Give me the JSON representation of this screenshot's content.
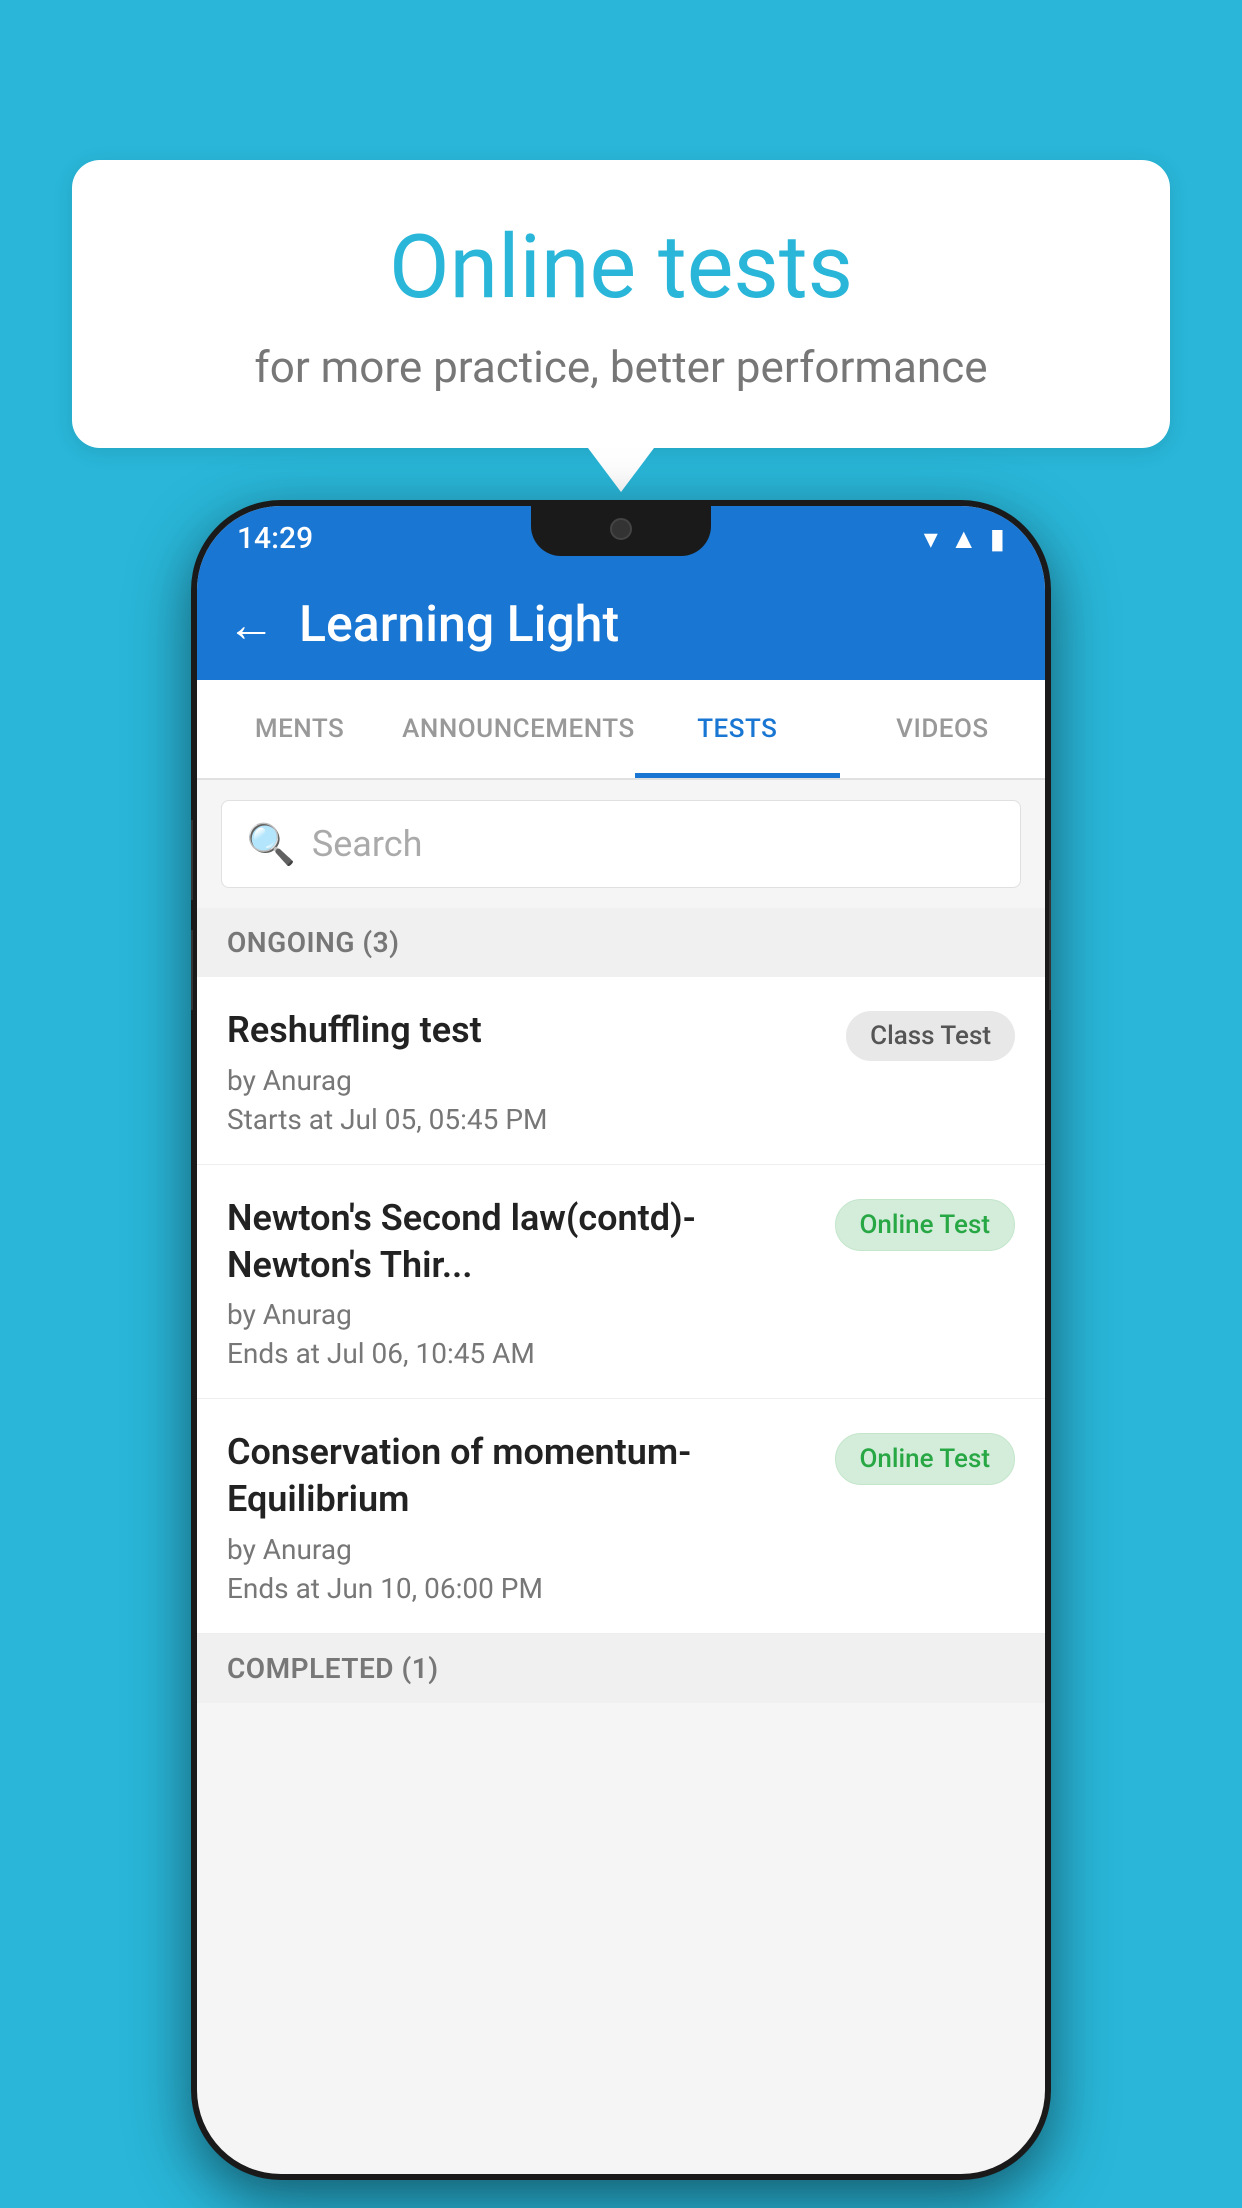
{
  "background_color": "#29b6d8",
  "speech_bubble": {
    "title": "Online tests",
    "subtitle": "for more practice, better performance"
  },
  "phone": {
    "status_bar": {
      "time": "14:29",
      "icons": [
        "▼",
        "▲",
        "▌"
      ]
    },
    "app_bar": {
      "back_label": "←",
      "title": "Learning Light"
    },
    "tabs": [
      {
        "label": "MENTS",
        "active": false
      },
      {
        "label": "ANNOUNCEMENTS",
        "active": false
      },
      {
        "label": "TESTS",
        "active": true
      },
      {
        "label": "VIDEOS",
        "active": false
      }
    ],
    "search": {
      "placeholder": "Search"
    },
    "sections": [
      {
        "header": "ONGOING (3)",
        "items": [
          {
            "name": "Reshuffling test",
            "author": "by Anurag",
            "date": "Starts at  Jul 05, 05:45 PM",
            "badge": "Class Test",
            "badge_type": "class"
          },
          {
            "name": "Newton's Second law(contd)-Newton's Thir...",
            "author": "by Anurag",
            "date": "Ends at  Jul 06, 10:45 AM",
            "badge": "Online Test",
            "badge_type": "online"
          },
          {
            "name": "Conservation of momentum-Equilibrium",
            "author": "by Anurag",
            "date": "Ends at  Jun 10, 06:00 PM",
            "badge": "Online Test",
            "badge_type": "online"
          }
        ]
      },
      {
        "header": "COMPLETED (1)",
        "items": []
      }
    ]
  }
}
